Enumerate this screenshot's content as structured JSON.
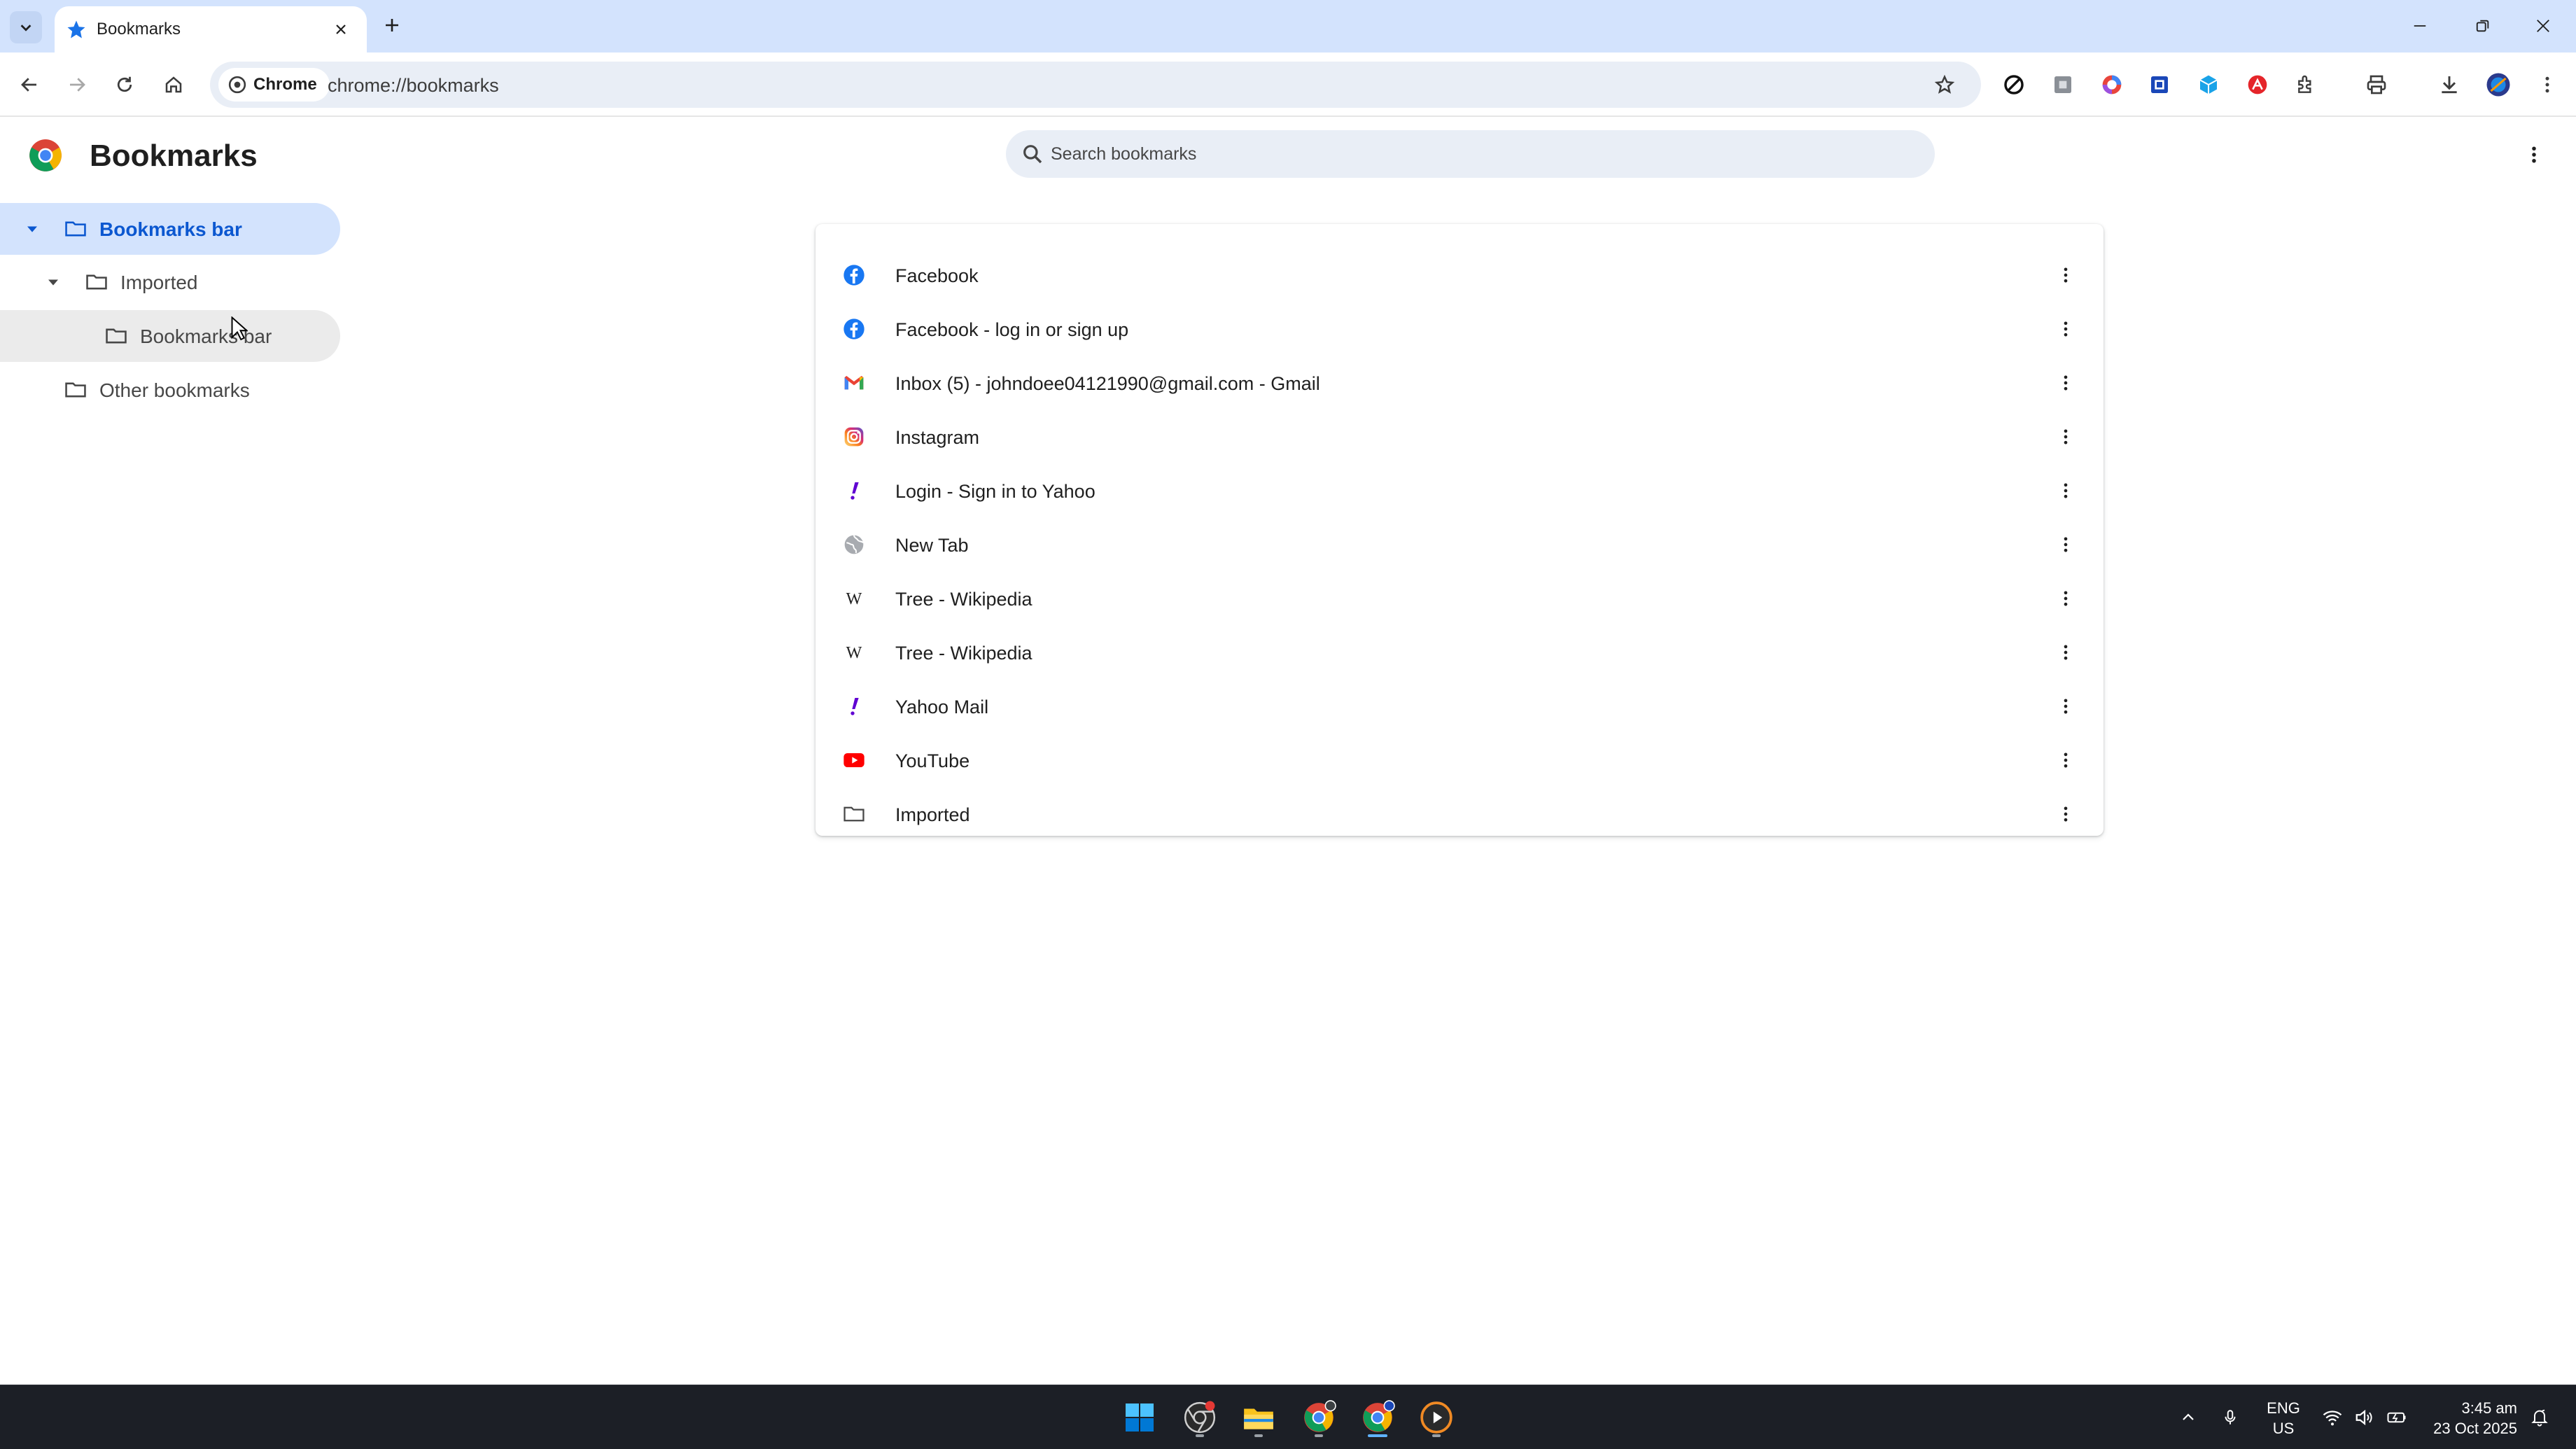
{
  "window": {
    "tab_title": "Bookmarks",
    "controls": [
      "minimize",
      "restore",
      "close"
    ]
  },
  "toolbar": {
    "site_chip_label": "Chrome",
    "url": "chrome://bookmarks"
  },
  "page": {
    "title": "Bookmarks",
    "search_placeholder": "Search bookmarks"
  },
  "sidebar": {
    "items": [
      {
        "label": "Bookmarks bar",
        "expanded": true,
        "selected": true
      },
      {
        "label": "Imported",
        "expanded": true,
        "selected": false
      },
      {
        "label": "Bookmarks bar",
        "selected": false,
        "hovered": true
      },
      {
        "label": "Other bookmarks",
        "selected": false
      }
    ]
  },
  "bookmarks": [
    {
      "title": "Facebook",
      "icon": "facebook-icon"
    },
    {
      "title": "Facebook - log in or sign up",
      "icon": "facebook-icon"
    },
    {
      "title": "Inbox (5) - johndoee04121990@gmail.com - Gmail",
      "icon": "gmail-icon"
    },
    {
      "title": "Instagram",
      "icon": "instagram-icon"
    },
    {
      "title": "Login - Sign in to Yahoo",
      "icon": "yahoo-icon"
    },
    {
      "title": "New Tab",
      "icon": "globe-icon"
    },
    {
      "title": "Tree - Wikipedia",
      "icon": "wikipedia-icon"
    },
    {
      "title": "Tree - Wikipedia",
      "icon": "wikipedia-icon"
    },
    {
      "title": "Yahoo Mail",
      "icon": "yahoo-icon"
    },
    {
      "title": "YouTube",
      "icon": "youtube-icon"
    },
    {
      "title": "Imported",
      "icon": "folder-icon"
    }
  ],
  "taskbar": {
    "language_line1": "ENG",
    "language_line2": "US",
    "time": "3:45 am",
    "date": "23 Oct 2025"
  },
  "colors": {
    "accent": "#0b57d0",
    "selected_bg": "#d3e3fd",
    "facebook": "#1877f2",
    "yahoo": "#6001d2",
    "youtube": "#ff0000",
    "taskbar_bg": "#1c1f26"
  }
}
